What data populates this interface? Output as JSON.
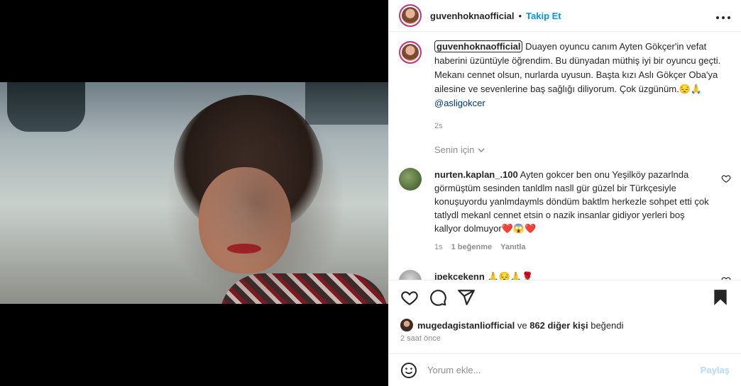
{
  "header": {
    "username": "guvenhoknaofficial",
    "separator": "•",
    "follow_label": "Takip Et",
    "more_icon": "more-horizontal-icon"
  },
  "caption": {
    "username": "guvenhoknaofficial",
    "text": " Duayen oyuncu canım Ayten Gökçer'in vefat haberini üzüntüyle öğrendim. Bu dünyadan müthiş iyi bir oyuncu geçti. Mekanı cennet olsun, nurlarda uyusun. Başta kızı Aslı Gökçer Oba'ya ailesine ve sevenlerine baş sağlığı diliyorum. Çok üzgünüm.😔🙏 ",
    "mention": "@asligokcer",
    "time": "2s"
  },
  "filter": {
    "label": "Senin için",
    "icon": "chevron-down-icon"
  },
  "comments": [
    {
      "username": "nurten.kaplan_.100",
      "text": " Ayten gokcer ben onu Yeşilköy pazarlnda görmüştüm sesinden tanldlm nasll gür güzel bir Türkçesiyle konuşuyordu yanlmdaymls döndüm baktlm herkezle sohpet etti çok tatlydl mekanl cennet etsin o nazik insanlar gidiyor yerleri boş kallyor dolmuyor❤️😱❤️",
      "time": "1s",
      "likes": "1 beğenme",
      "reply": "Yanıtla"
    },
    {
      "username": "ipekcekenn",
      "text": " 🙏😔🙏🌹"
    }
  ],
  "likes": {
    "user": "mugedagistanliofficial",
    "middle": " ve ",
    "count": "862 diğer kişi",
    "suffix": " beğendi"
  },
  "post_time": "2 saat önce",
  "add_comment": {
    "placeholder": "Yorum ekle...",
    "post_label": "Paylaş"
  },
  "colors": {
    "link": "#0095f6",
    "mention": "#00376b",
    "muted": "#8e8e8e",
    "post_disabled": "#b3dbff"
  }
}
